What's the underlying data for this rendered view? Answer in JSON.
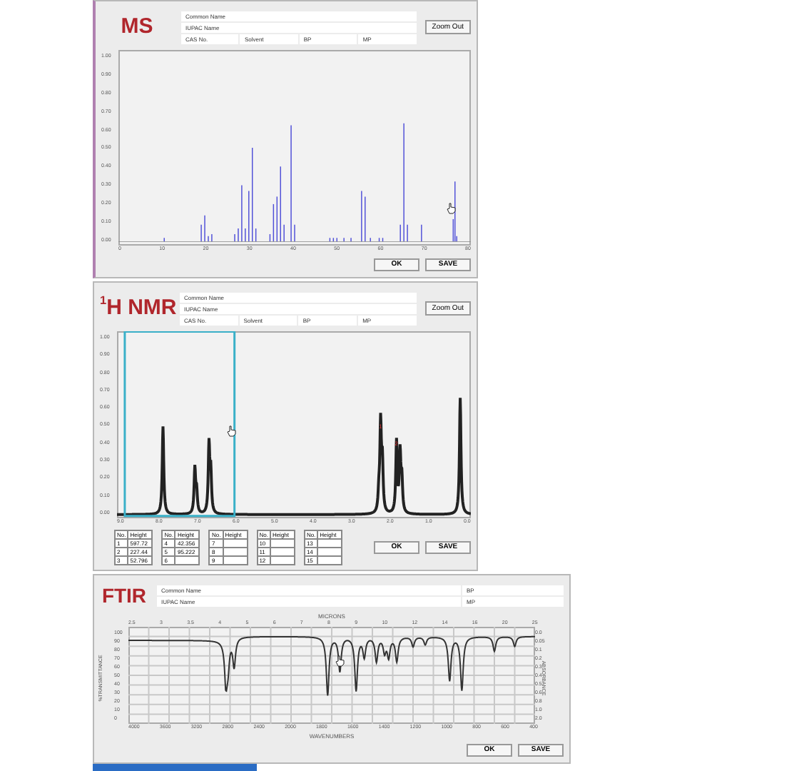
{
  "panels": [
    {
      "kind": "ms",
      "title": "MS",
      "fields": [
        "Common Name",
        "IUPAC Name",
        "CAS No.",
        "Solvent",
        "BP",
        "MP"
      ],
      "zoom_button": "Zoom Out",
      "y_ticks": [
        "1.00",
        "0.90",
        "0.80",
        "0.70",
        "0.60",
        "0.50",
        "0.40",
        "0.30",
        "0.20",
        "0.10",
        "0.00"
      ],
      "x_ticks": [
        "0",
        "10",
        "20",
        "30",
        "40",
        "50",
        "60",
        "70",
        "80"
      ],
      "buttons": [
        "OK",
        "SAVE"
      ]
    },
    {
      "kind": "nmr",
      "title": "$^{1}$H NMR",
      "fields": [
        "Common Name",
        "IUPAC Name",
        "CAS No.",
        "Solvent",
        "BP",
        "MP"
      ],
      "zoom_button": "Zoom Out",
      "y_ticks": [
        "1.00",
        "0.90",
        "0.80",
        "0.70",
        "0.60",
        "0.50",
        "0.40",
        "0.30",
        "0.20",
        "0.10",
        "0.00"
      ],
      "x_ticks": [
        "9.0",
        "8.0",
        "7.0",
        "6.0",
        "5.0",
        "4.0",
        "3.0",
        "2.0",
        "1.0",
        "0.0"
      ],
      "peak_labels": [
        "1",
        "2"
      ],
      "tables": [
        {
          "header": [
            "No.",
            "Height"
          ],
          "rows": [
            [
              "1",
              "597.72"
            ],
            [
              "2",
              "227.44"
            ],
            [
              "3",
              "52.796"
            ]
          ]
        },
        {
          "header": [
            "No.",
            "Height"
          ],
          "rows": [
            [
              "4",
              "42.356"
            ],
            [
              "5",
              "95.222"
            ],
            [
              "6",
              ""
            ]
          ]
        },
        {
          "header": [
            "No.",
            "Height"
          ],
          "rows": [
            [
              "7",
              ""
            ],
            [
              "8",
              ""
            ],
            [
              "9",
              ""
            ]
          ]
        },
        {
          "header": [
            "No.",
            "Height"
          ],
          "rows": [
            [
              "10",
              ""
            ],
            [
              "11",
              ""
            ],
            [
              "12",
              ""
            ]
          ]
        },
        {
          "header": [
            "No.",
            "Height"
          ],
          "rows": [
            [
              "13",
              ""
            ],
            [
              "14",
              ""
            ],
            [
              "15",
              ""
            ]
          ]
        }
      ],
      "buttons": [
        "OK",
        "SAVE"
      ]
    },
    {
      "kind": "ftir",
      "title": "FTIR",
      "fields": [
        "Common Name",
        "BP",
        "IUPAC Name",
        "MP"
      ],
      "top_label": "MICRONS",
      "x_label": "WAVENUMBERS",
      "y_label": "%TRANSMITTANCE",
      "right_label": "ABSORBANCE",
      "top_ticks": [
        "2.5",
        "3",
        "3.5",
        "4",
        "5",
        "6",
        "7",
        "8",
        "9",
        "10",
        "12",
        "14",
        "16",
        "20",
        "25"
      ],
      "x_ticks": [
        "4000",
        "3600",
        "3200",
        "2800",
        "2400",
        "2000",
        "1800",
        "1600",
        "1400",
        "1200",
        "1000",
        "800",
        "600",
        "400"
      ],
      "y_ticks": [
        "100",
        "90",
        "80",
        "70",
        "60",
        "50",
        "40",
        "30",
        "20",
        "10",
        "0"
      ],
      "right_ticks": [
        "0.0",
        "0.05",
        "0.1",
        "0.2",
        "0.3",
        "0.4",
        "0.5",
        "0.6",
        "0.8",
        "1.0",
        "2.0"
      ],
      "buttons": [
        "OK",
        "SAVE"
      ]
    }
  ]
}
